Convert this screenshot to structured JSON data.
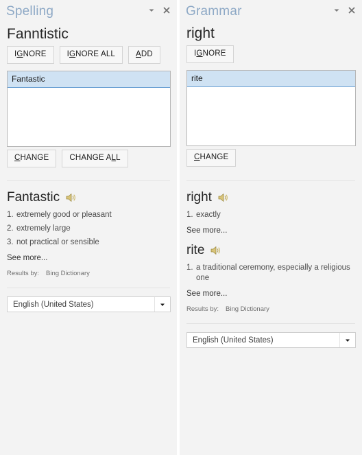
{
  "spelling_pane": {
    "title": "Spelling",
    "title_color": "#8ea9c6",
    "flagged_word": "Fanntistic",
    "actions": [
      {
        "id": "ignore",
        "label_pre": "I",
        "label_accel": "G",
        "label_post": "NORE"
      },
      {
        "id": "ignore-all",
        "label_pre": "I",
        "label_accel": "G",
        "label_post": "NORE ALL"
      },
      {
        "id": "add",
        "label_pre": "",
        "label_accel": "A",
        "label_post": "DD"
      }
    ],
    "suggestions": [
      {
        "text": "Fantastic",
        "selected": true
      }
    ],
    "change_actions": [
      {
        "id": "change",
        "label_pre": "",
        "label_accel": "C",
        "label_post": "HANGE"
      },
      {
        "id": "change-all",
        "label_pre": "CHANGE A",
        "label_accel": "L",
        "label_post": "L"
      }
    ],
    "dictionary": [
      {
        "word": "Fantastic",
        "definitions": [
          {
            "num": "1.",
            "text": "extremely good or pleasant"
          },
          {
            "num": "2.",
            "text": "extremely large"
          },
          {
            "num": "3.",
            "text": "not practical or sensible"
          }
        ],
        "see_more": "See more..."
      }
    ],
    "results_by_label": "Results by:",
    "results_by_source": "Bing Dictionary",
    "language": "English (United States)"
  },
  "grammar_pane": {
    "title": "Grammar",
    "title_color": "#8ea9c6",
    "flagged_word": "right",
    "actions": [
      {
        "id": "ignore",
        "label_pre": "I",
        "label_accel": "G",
        "label_post": "NORE"
      }
    ],
    "suggestions": [
      {
        "text": "rite",
        "selected": true
      }
    ],
    "change_actions": [
      {
        "id": "change",
        "label_pre": "",
        "label_accel": "C",
        "label_post": "HANGE"
      }
    ],
    "dictionary": [
      {
        "word": "right",
        "definitions": [
          {
            "num": "1.",
            "text": "exactly"
          }
        ],
        "see_more": "See more..."
      },
      {
        "word": "rite",
        "definitions": [
          {
            "num": "1.",
            "text": "a traditional ceremony, especially a religious one"
          }
        ],
        "see_more": "See more..."
      }
    ],
    "results_by_label": "Results by:",
    "results_by_source": "Bing Dictionary",
    "language": "English (United States)"
  },
  "icons": {
    "collapse": "chevron-down-icon",
    "close": "close-icon",
    "speaker": "speaker-icon",
    "dropdown": "chevron-down-icon"
  }
}
